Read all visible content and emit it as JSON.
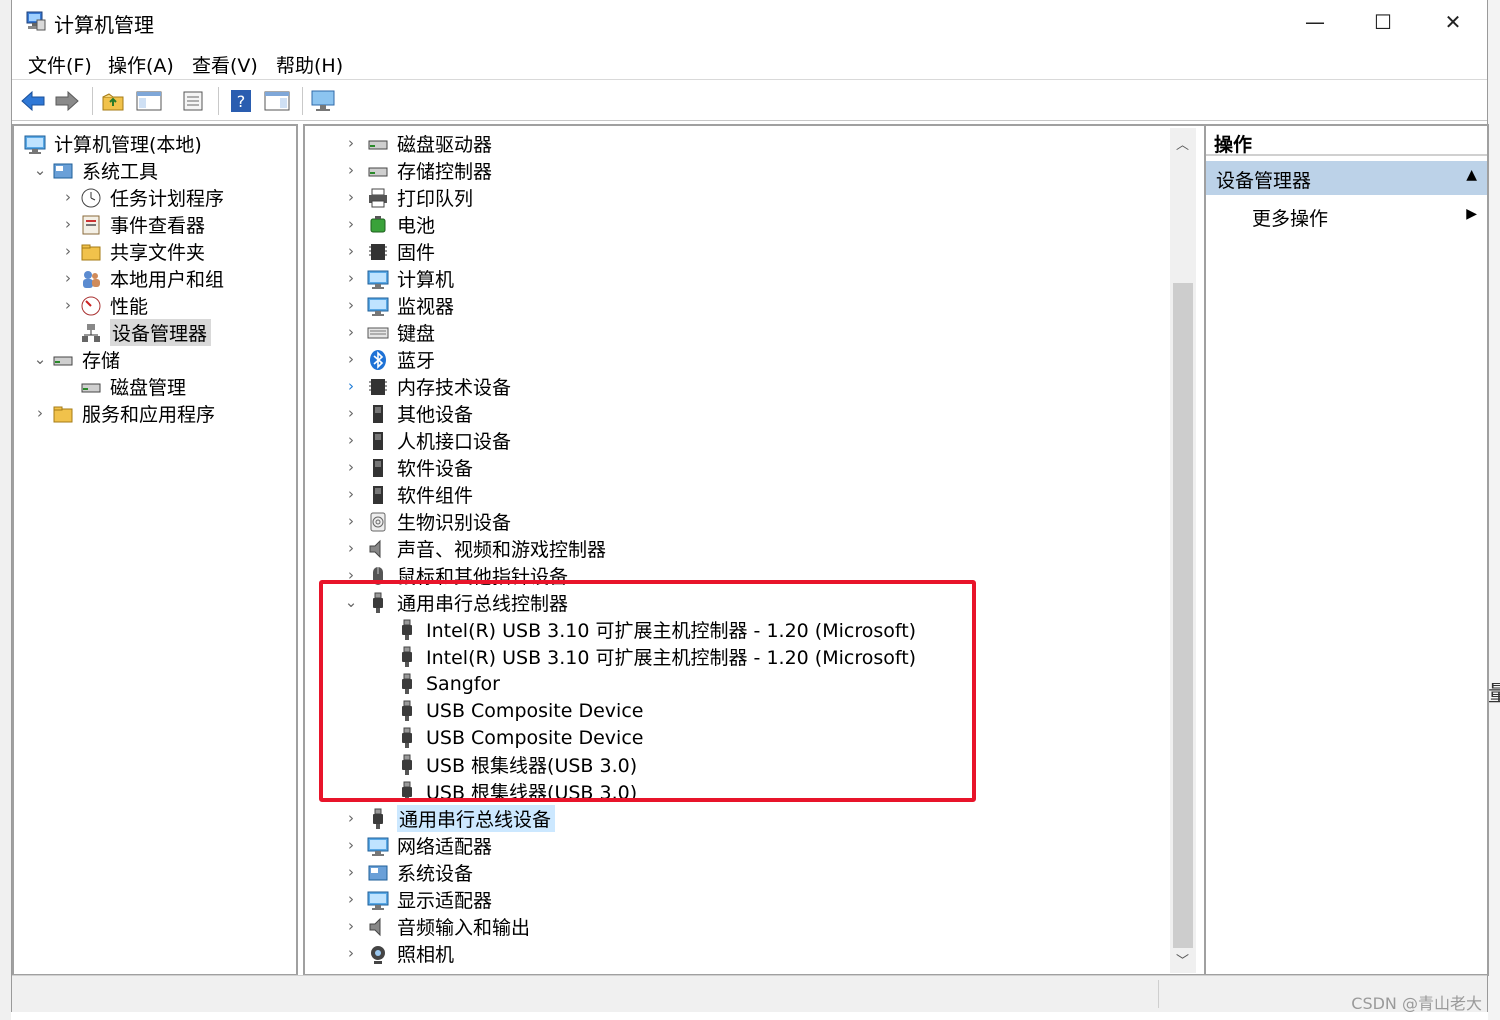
{
  "window": {
    "title": "计算机管理",
    "controls": {
      "minimize": "—",
      "maximize": "☐",
      "close": "✕"
    }
  },
  "menu": [
    "文件(F)",
    "操作(A)",
    "查看(V)",
    "帮助(H)"
  ],
  "left_tree": [
    {
      "label": "计算机管理(本地)",
      "indent": 0,
      "chevron": "",
      "icon": "computer-management-icon"
    },
    {
      "label": "系统工具",
      "indent": 1,
      "chevron": "⌄",
      "icon": "system-tools-icon"
    },
    {
      "label": "任务计划程序",
      "indent": 2,
      "chevron": "›",
      "icon": "task-scheduler-icon"
    },
    {
      "label": "事件查看器",
      "indent": 2,
      "chevron": "›",
      "icon": "event-viewer-icon"
    },
    {
      "label": "共享文件夹",
      "indent": 2,
      "chevron": "›",
      "icon": "shared-folders-icon"
    },
    {
      "label": "本地用户和组",
      "indent": 2,
      "chevron": "›",
      "icon": "local-users-icon"
    },
    {
      "label": "性能",
      "indent": 2,
      "chevron": "›",
      "icon": "performance-icon"
    },
    {
      "label": "设备管理器",
      "indent": 2,
      "chevron": "",
      "icon": "device-manager-icon",
      "selected": true
    },
    {
      "label": "存储",
      "indent": 1,
      "chevron": "⌄",
      "icon": "storage-icon"
    },
    {
      "label": "磁盘管理",
      "indent": 2,
      "chevron": "",
      "icon": "disk-management-icon"
    },
    {
      "label": "服务和应用程序",
      "indent": 1,
      "chevron": "›",
      "icon": "services-apps-icon"
    }
  ],
  "device_tree": [
    {
      "label": "磁盘驱动器",
      "level": 0,
      "chevron": "›",
      "icon": "disk-drive-icon"
    },
    {
      "label": "存储控制器",
      "level": 0,
      "chevron": "›",
      "icon": "storage-controller-icon"
    },
    {
      "label": "打印队列",
      "level": 0,
      "chevron": "›",
      "icon": "printer-icon"
    },
    {
      "label": "电池",
      "level": 0,
      "chevron": "›",
      "icon": "battery-icon"
    },
    {
      "label": "固件",
      "level": 0,
      "chevron": "›",
      "icon": "firmware-icon"
    },
    {
      "label": "计算机",
      "level": 0,
      "chevron": "›",
      "icon": "computer-icon"
    },
    {
      "label": "监视器",
      "level": 0,
      "chevron": "›",
      "icon": "monitor-icon"
    },
    {
      "label": "键盘",
      "level": 0,
      "chevron": "›",
      "icon": "keyboard-icon"
    },
    {
      "label": "蓝牙",
      "level": 0,
      "chevron": "›",
      "icon": "bluetooth-icon"
    },
    {
      "label": "内存技术设备",
      "level": 0,
      "chevron": "›",
      "icon": "memory-device-icon"
    },
    {
      "label": "其他设备",
      "level": 0,
      "chevron": "›",
      "icon": "other-device-icon"
    },
    {
      "label": "人机接口设备",
      "level": 0,
      "chevron": "›",
      "icon": "hid-icon"
    },
    {
      "label": "软件设备",
      "level": 0,
      "chevron": "›",
      "icon": "software-device-icon"
    },
    {
      "label": "软件组件",
      "level": 0,
      "chevron": "›",
      "icon": "software-component-icon"
    },
    {
      "label": "生物识别设备",
      "level": 0,
      "chevron": "›",
      "icon": "biometric-icon"
    },
    {
      "label": "声音、视频和游戏控制器",
      "level": 0,
      "chevron": "›",
      "icon": "sound-icon"
    },
    {
      "label": "鼠标和其他指针设备",
      "level": 0,
      "chevron": "›",
      "icon": "mouse-icon"
    },
    {
      "label": "通用串行总线控制器",
      "level": 0,
      "chevron": "⌄",
      "icon": "usb-icon"
    },
    {
      "label": "Intel(R) USB 3.10 可扩展主机控制器 - 1.20 (Microsoft)",
      "level": 1,
      "chevron": "",
      "icon": "usb-icon"
    },
    {
      "label": "Intel(R) USB 3.10 可扩展主机控制器 - 1.20 (Microsoft)",
      "level": 1,
      "chevron": "",
      "icon": "usb-icon"
    },
    {
      "label": "Sangfor",
      "level": 1,
      "chevron": "",
      "icon": "usb-icon"
    },
    {
      "label": "USB Composite Device",
      "level": 1,
      "chevron": "",
      "icon": "usb-icon"
    },
    {
      "label": "USB Composite Device",
      "level": 1,
      "chevron": "",
      "icon": "usb-icon"
    },
    {
      "label": "USB 根集线器(USB 3.0)",
      "level": 1,
      "chevron": "",
      "icon": "usb-icon"
    },
    {
      "label": "USB 根集线器(USB 3.0)",
      "level": 1,
      "chevron": "",
      "icon": "usb-icon"
    },
    {
      "label": "通用串行总线设备",
      "level": 0,
      "chevron": "›",
      "icon": "usb-icon",
      "selected": true
    },
    {
      "label": "网络适配器",
      "level": 0,
      "chevron": "›",
      "icon": "network-adapter-icon"
    },
    {
      "label": "系统设备",
      "level": 0,
      "chevron": "›",
      "icon": "system-device-icon"
    },
    {
      "label": "显示适配器",
      "level": 0,
      "chevron": "›",
      "icon": "display-adapter-icon"
    },
    {
      "label": "音频输入和输出",
      "level": 0,
      "chevron": "›",
      "icon": "audio-io-icon"
    },
    {
      "label": "照相机",
      "level": 0,
      "chevron": "›",
      "icon": "camera-icon"
    }
  ],
  "actions": {
    "header": "操作",
    "group": "设备管理器",
    "more": "更多操作"
  },
  "watermark": "CSDN @青山老大",
  "colors": {
    "highlight_box": "#e8142a",
    "selection": "#cce8ff",
    "actions_group": "#bcd2e8"
  }
}
